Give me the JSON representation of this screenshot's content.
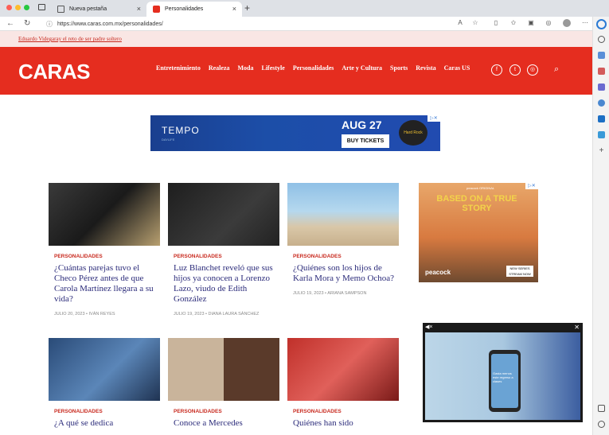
{
  "browser": {
    "tabs": [
      {
        "label": "Nueva pestaña"
      },
      {
        "label": "Personalidades"
      }
    ],
    "url": "https://www.caras.com.mx/personalidades/"
  },
  "site": {
    "top_news": "Eduardo Videgaray el reto de ser padre soltero",
    "logo": "CARAS",
    "menu": [
      "Entretenimiento",
      "Realeza",
      "Moda",
      "Lifestyle",
      "Personalidades",
      "Arte y Cultura",
      "Sports",
      "Revista",
      "Caras US"
    ]
  },
  "ads": {
    "banner": {
      "brand": "TEMPO",
      "sub": "DAYLIFE",
      "date": "AUG 27",
      "cta": "BUY TICKETS",
      "venue": "Hard Rock"
    },
    "side": {
      "top": "peacock ORIGINAL",
      "headline": "BASED ON A TRUE STORY",
      "brand": "peacock",
      "badge": "NEW SERIES STREAM NOW"
    },
    "video": {
      "screen_text": "Gasta menos este regreso a clases"
    }
  },
  "articles": [
    {
      "category": "PERSONALIDADES",
      "title": "¿Cuántas parejas tuvo el Checo Pérez antes de que Carola Martínez llegara a su vida?",
      "date": "JULIO 20, 2023",
      "author": "IVÁN REYES"
    },
    {
      "category": "PERSONALIDADES",
      "title": "Luz Blanchet reveló que sus hijos ya conocen a Lorenzo Lazo, viudo de Edith González",
      "date": "JULIO 19, 2023",
      "author": "DIANA LAURA SÁNCHEZ"
    },
    {
      "category": "PERSONALIDADES",
      "title": "¿Quiénes son los hijos de Karla Mora y Memo Ochoa?",
      "date": "JULIO 19, 2023",
      "author": "ARIANA SAMPSON"
    },
    {
      "category": "PERSONALIDADES",
      "title": "¿A qué se dedica",
      "date": "",
      "author": ""
    },
    {
      "category": "PERSONALIDADES",
      "title": "Conoce a Mercedes",
      "date": "",
      "author": ""
    },
    {
      "category": "PERSONALIDADES",
      "title": "Quiénes han sido",
      "date": "",
      "author": ""
    }
  ],
  "colors": {
    "brand_red": "#e52d1f",
    "link_red": "#c8291e",
    "title_navy": "#2b2b7a"
  }
}
